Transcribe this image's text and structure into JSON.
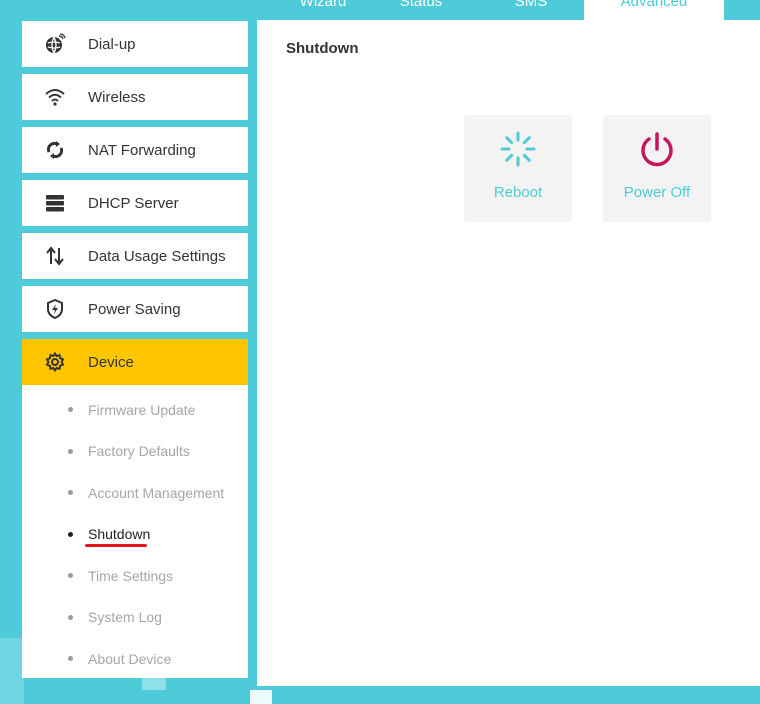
{
  "top_tabs": [
    "Wizard",
    "Status",
    "SMS",
    "Advanced"
  ],
  "active_tab": "Advanced",
  "sidebar": {
    "items": [
      {
        "label": "Dial-up",
        "icon": "globe-icon"
      },
      {
        "label": "Wireless",
        "icon": "wifi-icon"
      },
      {
        "label": "NAT Forwarding",
        "icon": "nat-forwarding-icon"
      },
      {
        "label": "DHCP Server",
        "icon": "server-icon"
      },
      {
        "label": "Data Usage Settings",
        "icon": "up-down-arrows-icon"
      },
      {
        "label": "Power Saving",
        "icon": "shield-bolt-icon"
      }
    ],
    "active": {
      "label": "Device",
      "icon": "gear-icon"
    },
    "submenu": [
      "Firmware Update",
      "Factory Defaults",
      "Account Management",
      "Shutdown",
      "Time Settings",
      "System Log",
      "About Device"
    ],
    "active_submenu": "Shutdown"
  },
  "main": {
    "title": "Shutdown",
    "actions": [
      {
        "label": "Reboot",
        "icon": "reboot-spinner-icon"
      },
      {
        "label": "Power Off",
        "icon": "power-icon"
      }
    ]
  },
  "colors": {
    "accent": "#4ecbd9",
    "active_menu": "#ffc600",
    "power_icon": "#c2185b",
    "underline": "#e1141e"
  }
}
